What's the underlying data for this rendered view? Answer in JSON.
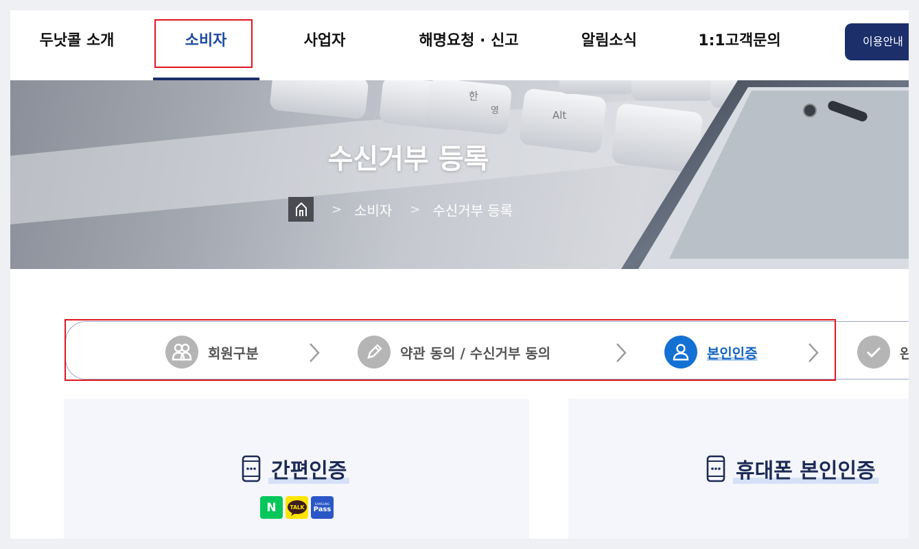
{
  "nav": {
    "items": [
      "두낫콜 소개",
      "소비자",
      "사업자",
      "해명요청 · 신고",
      "알림소식",
      "1:1고객문의"
    ],
    "guide_label": "이용안내"
  },
  "hero": {
    "title": "수신거부 등록",
    "breadcrumb": [
      "소비자",
      "수신거부 등록"
    ],
    "key_labels": [
      "한",
      "영",
      "Alt"
    ]
  },
  "steps": [
    {
      "label": "회원구분",
      "icon": "people-icon",
      "active": false
    },
    {
      "label": "약관 동의 / 수신거부 동의",
      "icon": "pencil-icon",
      "active": false
    },
    {
      "label": "본인인증",
      "icon": "person-icon",
      "active": true
    },
    {
      "label": "완",
      "icon": "check-icon",
      "active": false
    }
  ],
  "cards": [
    {
      "title": "간편인증",
      "icon": "phone-icon",
      "badges": [
        "N",
        "TALK",
        "Pass"
      ],
      "badge_caption": "SAMSUNG"
    },
    {
      "title": "휴대폰 본인인증",
      "icon": "phone-icon"
    }
  ],
  "colors": {
    "brand_navy": "#1c2f6b",
    "active_blue": "#1471d4",
    "highlight_red": "#e0141e",
    "naver_green": "#03c75a",
    "kakao_yellow": "#fee500",
    "pass_blue": "#2a56c6"
  }
}
